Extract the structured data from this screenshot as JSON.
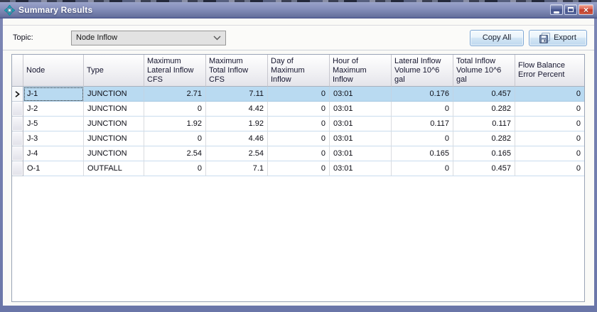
{
  "window": {
    "title": "Summary Results"
  },
  "icons": {
    "app": "node-compass-icon",
    "minimize": "minimize-icon",
    "maximize": "maximize-icon",
    "close": "close-icon",
    "close_glyph": "×",
    "dropdown": "chevron-down-icon",
    "export": "floppy-disk-icon",
    "selected_row": "right-arrow-icon"
  },
  "toolbar": {
    "topic_label": "Topic:",
    "topic_value": "Node Inflow",
    "copy_all_label": "Copy All",
    "export_label": "Export"
  },
  "table": {
    "columns": [
      "Node",
      "Type",
      "Maximum\nLateral Inflow\nCFS",
      "Maximum\nTotal Inflow\nCFS",
      "Day of\nMaximum\nInflow",
      "Hour of\nMaximum\nInflow",
      "Lateral Inflow\nVolume 10^6\ngal",
      "Total Inflow\nVolume 10^6\ngal",
      "Flow Balance\nError Percent"
    ],
    "selected_row_index": 0,
    "rows": [
      {
        "cells": [
          "J-1",
          "JUNCTION",
          "2.71",
          "7.11",
          "0",
          "03:01",
          "0.176",
          "0.457",
          "0"
        ]
      },
      {
        "cells": [
          "J-2",
          "JUNCTION",
          "0",
          "4.42",
          "0",
          "03:01",
          "0",
          "0.282",
          "0"
        ]
      },
      {
        "cells": [
          "J-5",
          "JUNCTION",
          "1.92",
          "1.92",
          "0",
          "03:01",
          "0.117",
          "0.117",
          "0"
        ]
      },
      {
        "cells": [
          "J-3",
          "JUNCTION",
          "0",
          "4.46",
          "0",
          "03:01",
          "0",
          "0.282",
          "0"
        ]
      },
      {
        "cells": [
          "J-4",
          "JUNCTION",
          "2.54",
          "2.54",
          "0",
          "03:01",
          "0.165",
          "0.165",
          "0"
        ]
      },
      {
        "cells": [
          "O-1",
          "OUTFALL",
          "0",
          "7.1",
          "0",
          "03:01",
          "0",
          "0.457",
          "0"
        ]
      }
    ]
  },
  "colors": {
    "titlebar_top": "#9aa3c9",
    "titlebar_bottom": "#5a6698",
    "selection": "#b9daf1",
    "button_border": "#7da7d4",
    "grid_line_horizontal": "#c9dcee",
    "grid_line_vertical": "#dadce0",
    "icon_teal": "#1fa3b5",
    "close_red": "#c23c2c"
  }
}
